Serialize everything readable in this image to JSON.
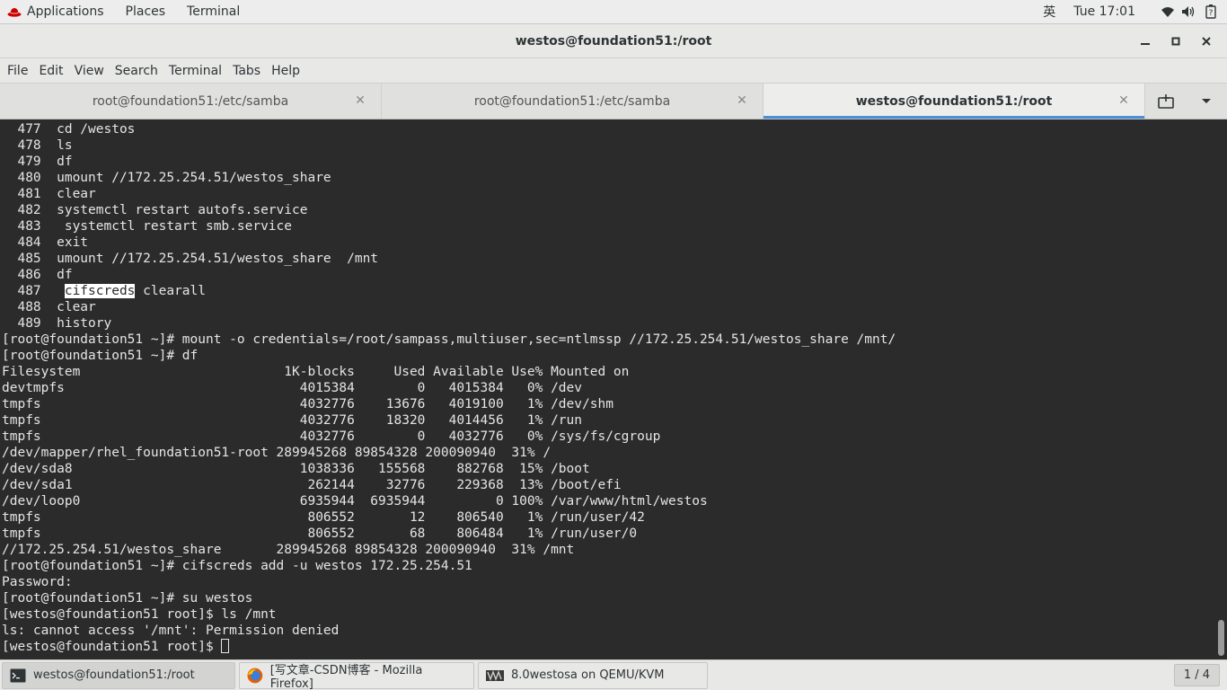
{
  "topbar": {
    "applications": "Applications",
    "places": "Places",
    "terminal": "Terminal",
    "input_method": "英",
    "clock": "Tue 17:01"
  },
  "window": {
    "title": "westos@foundation51:/root"
  },
  "menubar": [
    "File",
    "Edit",
    "View",
    "Search",
    "Terminal",
    "Tabs",
    "Help"
  ],
  "tabs": [
    {
      "label": "root@foundation51:/etc/samba",
      "active": false
    },
    {
      "label": "root@foundation51:/etc/samba",
      "active": false
    },
    {
      "label": "westos@foundation51:/root",
      "active": true
    }
  ],
  "terminal": {
    "lines": [
      "  477  cd /westos",
      "  478  ls",
      "  479  df",
      "  480  umount //172.25.254.51/westos_share",
      "  481  clear",
      "  482  systemctl restart autofs.service",
      "  483   systemctl restart smb.service",
      "  484  exit",
      "  485  umount //172.25.254.51/westos_share  /mnt",
      "  486  df",
      "  487   ",
      "  488  clear",
      "  489  history",
      "[root@foundation51 ~]# mount -o credentials=/root/sampass,multiuser,sec=ntlmssp //172.25.254.51/westos_share /mnt/",
      "[root@foundation51 ~]# df",
      "Filesystem                          1K-blocks     Used Available Use% Mounted on",
      "devtmpfs                              4015384        0   4015384   0% /dev",
      "tmpfs                                 4032776    13676   4019100   1% /dev/shm",
      "tmpfs                                 4032776    18320   4014456   1% /run",
      "tmpfs                                 4032776        0   4032776   0% /sys/fs/cgroup",
      "/dev/mapper/rhel_foundation51-root 289945268 89854328 200090940  31% /",
      "/dev/sda8                             1038336   155568    882768  15% /boot",
      "/dev/sda1                              262144    32776    229368  13% /boot/efi",
      "/dev/loop0                            6935944  6935944         0 100% /var/www/html/westos",
      "tmpfs                                  806552       12    806540   1% /run/user/42",
      "tmpfs                                  806552       68    806484   1% /run/user/0",
      "//172.25.254.51/westos_share       289945268 89854328 200090940  31% /mnt",
      "[root@foundation51 ~]# cifscreds add -u westos 172.25.254.51",
      "Password:",
      "[root@foundation51 ~]# su westos",
      "[westos@foundation51 root]$ ls /mnt",
      "ls: cannot access '/mnt': Permission denied",
      "[westos@foundation51 root]$ "
    ],
    "highlight_word": "cifscreds",
    "highlight_rest": " clearall"
  },
  "taskbar": {
    "tasks": [
      {
        "label": "westos@foundation51:/root",
        "icon": "terminal-icon"
      },
      {
        "label": "[写文章-CSDN博客 - Mozilla Firefox]",
        "icon": "firefox-icon"
      },
      {
        "label": "8.0westosa on QEMU/KVM",
        "icon": "virt-manager-icon"
      }
    ],
    "workspace": "1 / 4"
  }
}
